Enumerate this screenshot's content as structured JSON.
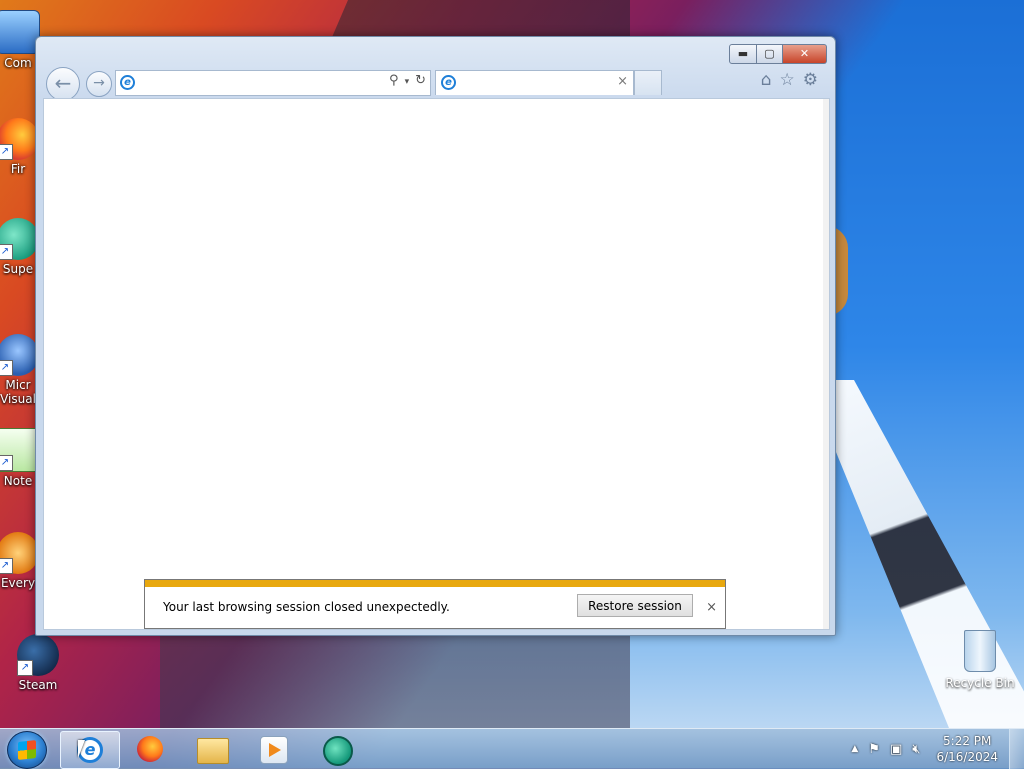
{
  "desktop": {
    "icons": [
      {
        "label": "Com",
        "icon": "computer-icon"
      },
      {
        "label": "Fir",
        "icon": "firefox-icon"
      },
      {
        "label": "Supe",
        "icon": "supercopier-icon"
      },
      {
        "label": "Micr\nVisual",
        "icon": "visual-studio-icon"
      },
      {
        "label": "Note",
        "icon": "notepad-icon"
      },
      {
        "label": "Every",
        "icon": "everything-icon"
      },
      {
        "label": "Steam",
        "icon": "steam-icon"
      }
    ],
    "recycle_bin": {
      "label": "Recycle Bin",
      "icon": "recycle-bin-icon"
    }
  },
  "browser": {
    "address": {
      "value": "",
      "placeholder": ""
    },
    "tab": {
      "title": "",
      "close_glyph": "×"
    },
    "window_buttons": {
      "minimize": "▬",
      "maximize": "▢",
      "close": "✕"
    },
    "toolbar_icons": [
      "home-icon",
      "star-icon",
      "gear-icon"
    ],
    "notification": {
      "message": "Your last browsing session closed unexpectedly.",
      "restore_label": "Restore session",
      "close_glyph": "×",
      "accent_color": "#e8a80f"
    }
  },
  "taskbar": {
    "items": [
      "internet-explorer",
      "firefox",
      "file-explorer",
      "media-player",
      "sticky-app"
    ],
    "active": "internet-explorer",
    "clock": {
      "time": "5:22 PM",
      "date": "6/16/2024"
    }
  }
}
